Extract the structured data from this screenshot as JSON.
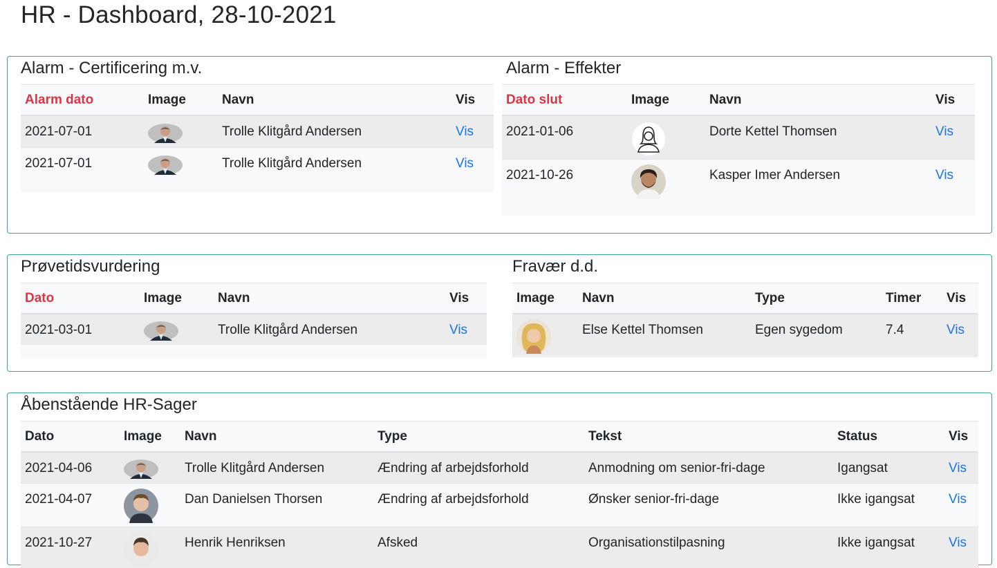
{
  "page": {
    "title": "HR - Dashboard, 28-10-2021"
  },
  "certificering": {
    "title": "Alarm - Certificering m.v.",
    "headers": [
      "Alarm dato",
      "Image",
      "Navn",
      "Vis"
    ],
    "rows": [
      {
        "date": "2021-07-01",
        "name": "Trolle Klitgård Andersen",
        "link": "Vis"
      },
      {
        "date": "2021-07-01",
        "name": "Trolle Klitgård Andersen",
        "link": "Vis"
      }
    ]
  },
  "effekter": {
    "title": "Alarm - Effekter",
    "headers": [
      "Dato slut",
      "Image",
      "Navn",
      "Vis"
    ],
    "rows": [
      {
        "date": "2021-01-06",
        "name": "Dorte Kettel Thomsen",
        "link": "Vis"
      },
      {
        "date": "2021-10-26",
        "name": "Kasper Imer Andersen",
        "link": "Vis"
      }
    ]
  },
  "proevetid": {
    "title": "Prøvetidsvurdering",
    "headers": [
      "Dato",
      "Image",
      "Navn",
      "Vis"
    ],
    "rows": [
      {
        "date": "2021-03-01",
        "name": "Trolle Klitgård Andersen",
        "link": "Vis"
      }
    ]
  },
  "fravaer": {
    "title": "Fravær d.d.",
    "headers": [
      "Image",
      "Navn",
      "Type",
      "Timer",
      "Vis"
    ],
    "rows": [
      {
        "name": "Else Kettel Thomsen",
        "type": "Egen sygedom",
        "hours": "7.4",
        "link": "Vis"
      }
    ]
  },
  "sager": {
    "title": "Åbenstående HR-Sager",
    "headers": [
      "Dato",
      "Image",
      "Navn",
      "Type",
      "Tekst",
      "Status",
      "Vis"
    ],
    "rows": [
      {
        "date": "2021-04-06",
        "name": "Trolle Klitgård Andersen",
        "type": "Ændring af arbejdsforhold",
        "text": "Anmodning om senior-fri-dage",
        "status": "Igangsat",
        "link": "Vis"
      },
      {
        "date": "2021-04-07",
        "name": "Dan Danielsen Thorsen",
        "type": "Ændring af arbejdsforhold",
        "text": "Ønsker senior-fri-dage",
        "status": "Ikke igangsat",
        "link": "Vis"
      },
      {
        "date": "2021-10-27",
        "name": "Henrik Henriksen",
        "type": "Afsked",
        "text": "Organisationstilpasning",
        "status": "Ikke igangsat",
        "link": "Vis"
      }
    ]
  },
  "colors": {
    "alarm_header": "#dc3545",
    "link": "#1a73e8",
    "card_border": "#3aa39b"
  }
}
